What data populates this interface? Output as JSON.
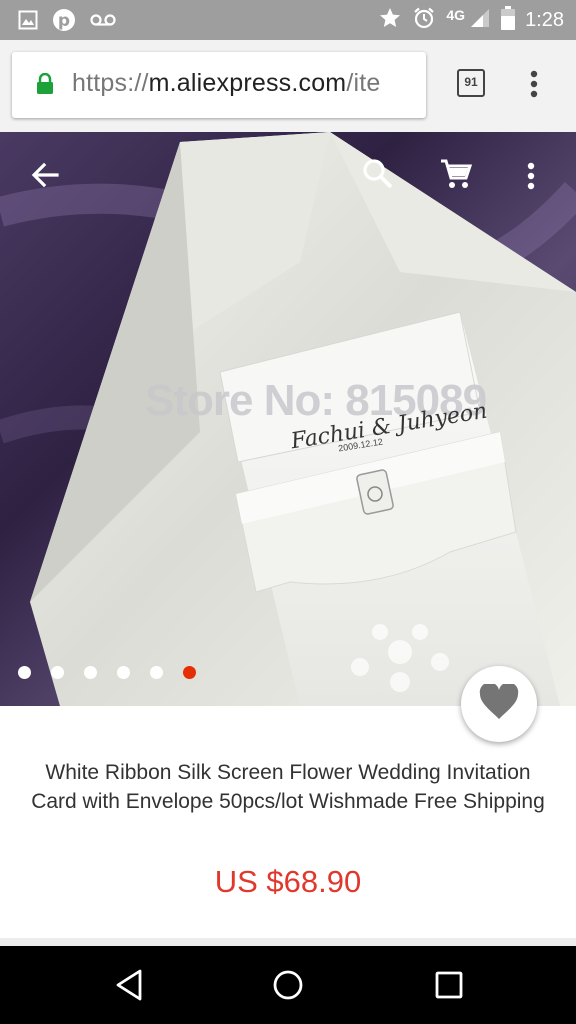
{
  "status_bar": {
    "network": "4G",
    "time": "1:28",
    "icons": [
      "image-icon",
      "pinterest-icon",
      "voicemail-icon",
      "star-icon",
      "alarm-icon",
      "signal-icon",
      "battery-icon"
    ]
  },
  "url_bar": {
    "scheme": "https://",
    "host": "m.aliexpress.com",
    "path": "/ite",
    "tab_count": "91"
  },
  "hero": {
    "watermark": "Store No: 815089",
    "card_names": "Fachui & Juhyeon",
    "card_date": "2009.12.12",
    "slide_count": 6,
    "active_slide": 5
  },
  "product": {
    "title": "White Ribbon Silk Screen Flower Wedding Invitation Card with Envelope 50pcs/lot Wishmade Free Shipping",
    "price": "US $68.90"
  },
  "colors": {
    "accent": "#e62e04",
    "price": "#e1382d",
    "lock": "#1da23a"
  }
}
